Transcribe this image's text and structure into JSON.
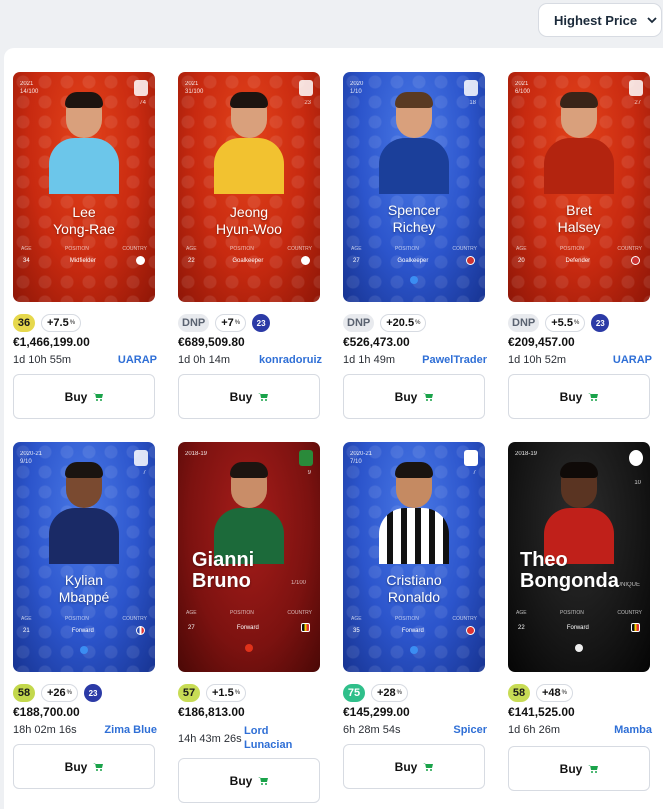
{
  "sort": {
    "label": "Highest Price"
  },
  "row1": [
    {
      "meta1": "2021",
      "meta2": "14/100",
      "num": "74",
      "first": "Lee",
      "last": "Yong-Rae",
      "age_label": "AGE",
      "pos_label": "POSITION",
      "country_label": "COUNTRY",
      "age": "34",
      "position": "Midfielder",
      "score": "36",
      "bonus": "+7.5",
      "pct": "%",
      "price": "€1,466,199.00",
      "time": "1d 10h 55m",
      "seller": "UARAP",
      "buy": "Buy"
    },
    {
      "meta1": "2021",
      "meta2": "31/100",
      "num": "23",
      "first": "Jeong",
      "last": "Hyun-Woo",
      "age_label": "AGE",
      "pos_label": "POSITION",
      "country_label": "COUNTRY",
      "age": "22",
      "position": "Goalkeeper",
      "score": "DNP",
      "bonus": "+7",
      "pct": "%",
      "level": "23",
      "price": "€689,509.80",
      "time": "1d 0h 14m",
      "seller": "konradoruiz",
      "buy": "Buy"
    },
    {
      "meta1": "2020",
      "meta2": "1/10",
      "num": "18",
      "first": "Spencer",
      "last": "Richey",
      "age_label": "AGE",
      "pos_label": "POSITION",
      "country_label": "COUNTRY",
      "age": "27",
      "position": "Goalkeeper",
      "score": "DNP",
      "bonus": "+20.5",
      "pct": "%",
      "price": "€526,473.00",
      "time": "1d 1h 49m",
      "seller": "PawelTrader",
      "buy": "Buy"
    },
    {
      "meta1": "2021",
      "meta2": "6/100",
      "num": "27",
      "first": "Bret",
      "last": "Halsey",
      "age_label": "AGE",
      "pos_label": "POSITION",
      "country_label": "COUNTRY",
      "age": "20",
      "position": "Defender",
      "score": "DNP",
      "bonus": "+5.5",
      "pct": "%",
      "level": "23",
      "price": "€209,457.00",
      "time": "1d 10h 52m",
      "seller": "UARAP",
      "buy": "Buy"
    }
  ],
  "row2": [
    {
      "meta1": "2020-21",
      "meta2": "9/10",
      "num": "7",
      "first": "Kylian",
      "last": "Mbappé",
      "age_label": "AGE",
      "pos_label": "POSITION",
      "country_label": "COUNTRY",
      "age": "21",
      "position": "Forward",
      "score": "58",
      "bonus": "+26",
      "pct": "%",
      "level": "23",
      "price": "€188,700.00",
      "time": "18h 02m 16s",
      "seller": "Zima Blue",
      "buy": "Buy"
    },
    {
      "meta1": "2018-19",
      "meta2": "",
      "num": "9",
      "first": "Gianni",
      "last": "Bruno",
      "serial": "1/100",
      "age_label": "AGE",
      "pos_label": "POSITION",
      "country_label": "COUNTRY",
      "age": "27",
      "position": "Forward",
      "score": "57",
      "bonus": "+1.5",
      "pct": "%",
      "price": "€186,813.00",
      "time": "14h 43m 26s",
      "seller": "Lord Lunacian",
      "buy": "Buy"
    },
    {
      "meta1": "2020-21",
      "meta2": "7/10",
      "num": "7",
      "first": "Cristiano",
      "last": "Ronaldo",
      "age_label": "AGE",
      "pos_label": "POSITION",
      "country_label": "COUNTRY",
      "age": "35",
      "position": "Forward",
      "score": "75",
      "bonus": "+28",
      "pct": "%",
      "price": "€145,299.00",
      "time": "6h 28m 54s",
      "seller": "Spicer",
      "buy": "Buy"
    },
    {
      "meta1": "2018-19",
      "meta2": "",
      "num": "10",
      "first": "Theo",
      "last": "Bongonda",
      "serial": "UNIQUE",
      "age_label": "AGE",
      "pos_label": "POSITION",
      "country_label": "COUNTRY",
      "age": "22",
      "position": "Forward",
      "score": "58",
      "bonus": "+48",
      "pct": "%",
      "price": "€141,525.00",
      "time": "1d 6h 26m",
      "seller": "Mamba",
      "buy": "Buy"
    }
  ],
  "colors": {
    "link": "#2f6fd6",
    "score_yellow": "#e6d84c",
    "score_green": "#98c74f",
    "score_teal": "#2fbf8a",
    "level": "#2b3aa6"
  },
  "icons": {
    "sort": "chevron-down-icon",
    "buy": "cart-icon",
    "crest": "club-crest-icon",
    "flag": "country-flag-icon"
  }
}
